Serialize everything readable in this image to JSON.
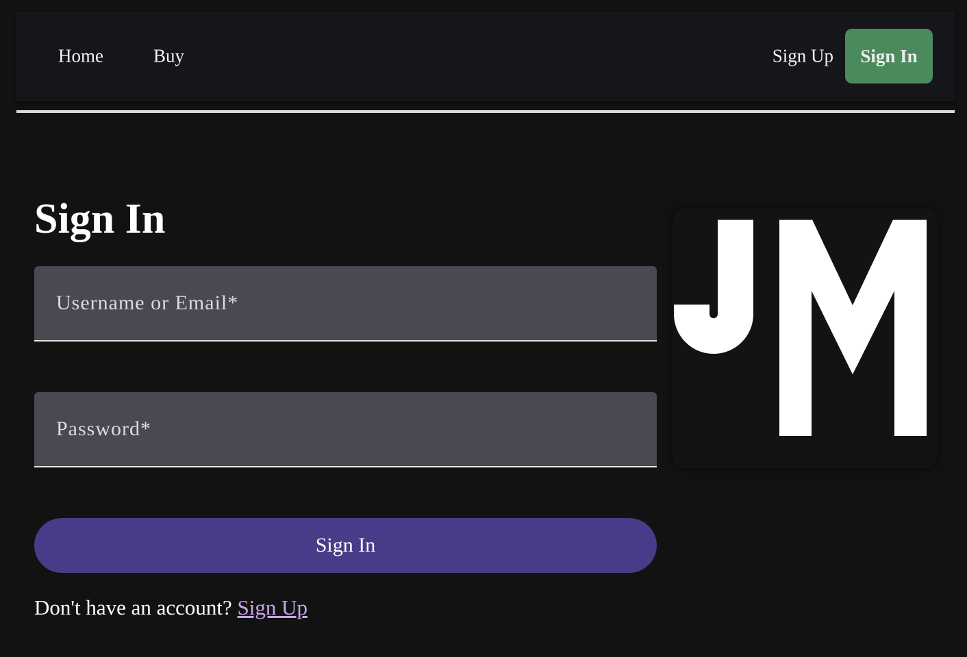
{
  "nav": {
    "home_label": "Home",
    "buy_label": "Buy",
    "signup_label": "Sign Up",
    "signin_label": "Sign In",
    "signin_button_color": "#4a8a5c"
  },
  "form": {
    "title": "Sign In",
    "username_placeholder": "Username or Email*",
    "username_value": "",
    "password_placeholder": "Password*",
    "password_value": "",
    "submit_label": "Sign In",
    "submit_color": "#473c87",
    "prompt_text": "Don't have an account?",
    "prompt_link_label": "Sign Up",
    "link_color": "#c8a6ec"
  },
  "logo": {
    "text": "JM",
    "icon": "jm-logo-icon"
  },
  "colors": {
    "background": "#121212",
    "navbar": "#16151a",
    "input_fill": "#4a4850"
  }
}
